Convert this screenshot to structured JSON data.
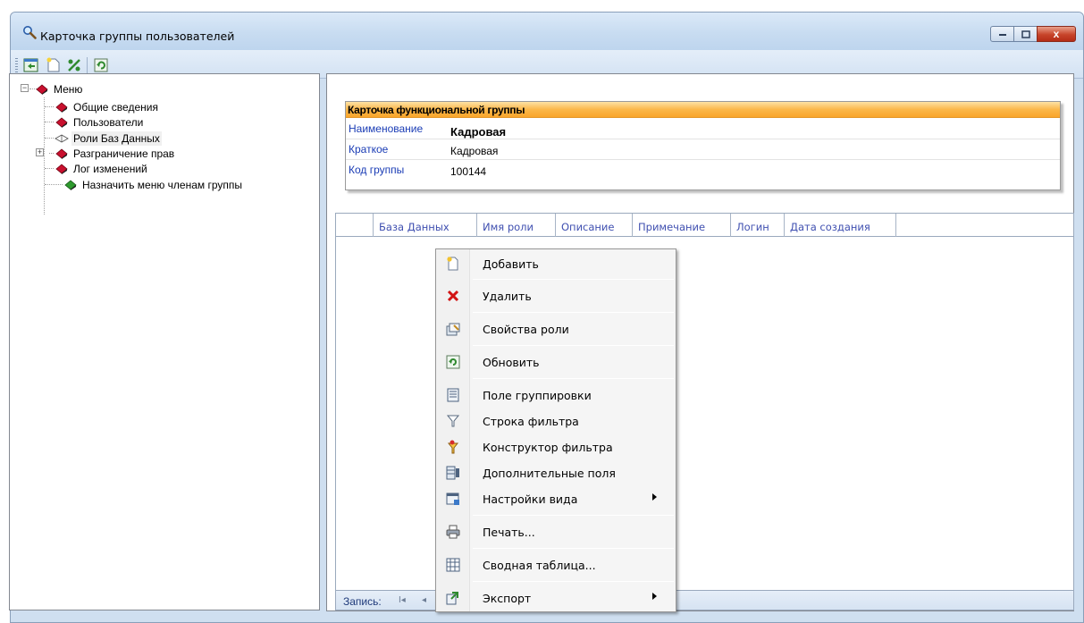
{
  "window": {
    "title": "Карточка группы пользователей",
    "close_glyph": "x"
  },
  "toolbar": {
    "buttons": [
      "window-restore-icon",
      "new-document-icon",
      "percent-icon",
      "refresh-icon"
    ]
  },
  "tree": {
    "root": "Меню",
    "items": [
      "Общие сведения",
      "Пользователи",
      "Роли Баз Данных",
      "Разграничение прав",
      "Лог изменений",
      "Назначить меню членам группы"
    ],
    "expander_collapsed": "+",
    "expander_expanded": "−"
  },
  "card": {
    "header": "Карточка функциональной группы",
    "rows": [
      {
        "label": "Наименование",
        "value": "Кадровая"
      },
      {
        "label": "Краткое",
        "value": "Кадровая"
      },
      {
        "label": "Код группы",
        "value": "100144"
      }
    ]
  },
  "grid": {
    "columns": [
      "База Данных",
      "Имя роли",
      "Описание",
      "Примечание",
      "Логин",
      "Дата создания"
    ],
    "footer_label": "Запись:",
    "nav_first": "I◂",
    "nav_prev": "◂"
  },
  "context_menu": {
    "items": [
      {
        "label": "Добавить",
        "icon": "add-document-icon"
      },
      {
        "label": "Удалить",
        "icon": "delete-x-icon"
      },
      {
        "label": "Свойства роли",
        "icon": "properties-icon"
      },
      {
        "label": "Обновить",
        "icon": "refresh-icon"
      },
      {
        "label": "Поле группировки",
        "icon": "group-field-icon"
      },
      {
        "label": "Строка фильтра",
        "icon": "filter-icon"
      },
      {
        "label": "Конструктор фильтра",
        "icon": "filter-builder-icon"
      },
      {
        "label": "Дополнительные поля",
        "icon": "extra-fields-icon"
      },
      {
        "label": "Настройки вида",
        "icon": "view-settings-icon"
      },
      {
        "label": "Печать...",
        "icon": "print-icon"
      },
      {
        "label": "Сводная таблица...",
        "icon": "pivot-table-icon"
      },
      {
        "label": "Экспорт",
        "icon": "export-icon"
      }
    ]
  },
  "colors": {
    "title_bar": "#c8dcf1",
    "card_header": "#fbb74a",
    "label_blue": "#1a3cb5",
    "close_red": "#c7442a"
  }
}
